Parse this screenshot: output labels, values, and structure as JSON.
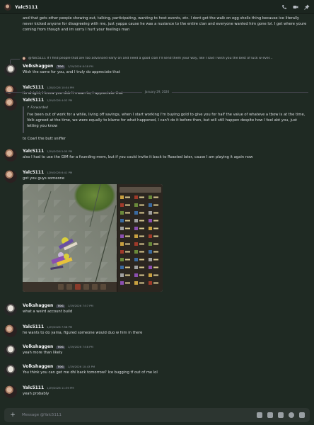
{
  "header": {
    "title": "Yalc5111"
  },
  "messages": [
    {
      "text": "and that gets other people showing out, talking, participating, wanting to host events, etc. I dont get the walk on egg shells thing because ive literally never kicked anyone for disagreeing with me, just yappa cause he was a nusiance to the entire clan and everyone wanted him gone lol. I get where youre coming from though and im sorry I hurt your feelings man"
    },
    {
      "reply": "@Yalc5111 If I find people that are too advanced early on and need a good clan I'll send them your way, like I said I wish you the best of luck w ever...",
      "author": "Volkshaggen",
      "tag": "TOG",
      "time": "1/29/2026 8:38 PM",
      "text": "Wish the same for you, and I truly do appreciate that"
    },
    {
      "author": "Yalc5111",
      "time": "1/28/2026 10:54 PM",
      "text": "its alright, I know you didn't mean to, I appreciate that"
    },
    {
      "divider": "January 29, 2026"
    },
    {
      "author": "Yalc5111",
      "time": "1/29/2026 4:02 PM",
      "forwarded": "Forwarded",
      "text": "I've been out of work for a while, living off savings, when I start working I'm buying gold to give you for half the value of whateve a tbow is at the time, Volk agreed at the time, we were equally to blame for what happened, I can't do it before then, but will still happen despite how I feel abt you, just letting you know",
      "text2": "to Coarl the butt sniffer"
    },
    {
      "author": "Yalc5111",
      "time": "1/29/2026 5:05 PM",
      "text": "also I had to use the GIM for a founding mem, but if you could invite it back to Roasted later, cause I am playing it again now"
    },
    {
      "author": "Yalc5111",
      "time": "1/29/2026 6:41 PM",
      "text": "got you guys someone"
    },
    {
      "author": "Volkshaggen",
      "tag": "TOG",
      "time": "1/29/2026 7:57 PM",
      "text": "what a weird account build"
    },
    {
      "author": "Yalc5111",
      "time": "1/29/2026 7:58 PM",
      "text": "he wants to do yama, figured someone would duo w him in there"
    },
    {
      "author": "Volkshaggen",
      "tag": "TOG",
      "time": "1/29/2026 7:58 PM",
      "text": "yeah more than likely"
    },
    {
      "author": "Volkshaggen",
      "tag": "TOG",
      "time": "1/29/2026 10:43 PM",
      "text": "You think you can get me dhl back tomorrow? Ice bugging tf out of me lol"
    },
    {
      "author": "Yalc5111",
      "time": "1/29/2026 11:39 PM",
      "text": "yeah probably"
    }
  ],
  "composer": {
    "placeholder": "Message @Yalc5111"
  },
  "icons": [
    "phone-icon",
    "video-icon",
    "pin-icon",
    "plus-icon",
    "gift-icon",
    "gif-icon",
    "sticker-icon",
    "emoji-icon",
    "apps-icon"
  ],
  "colors": {
    "background": "#1f2a23",
    "header": "#1b251f",
    "tag_bg": "#3a3f46"
  }
}
